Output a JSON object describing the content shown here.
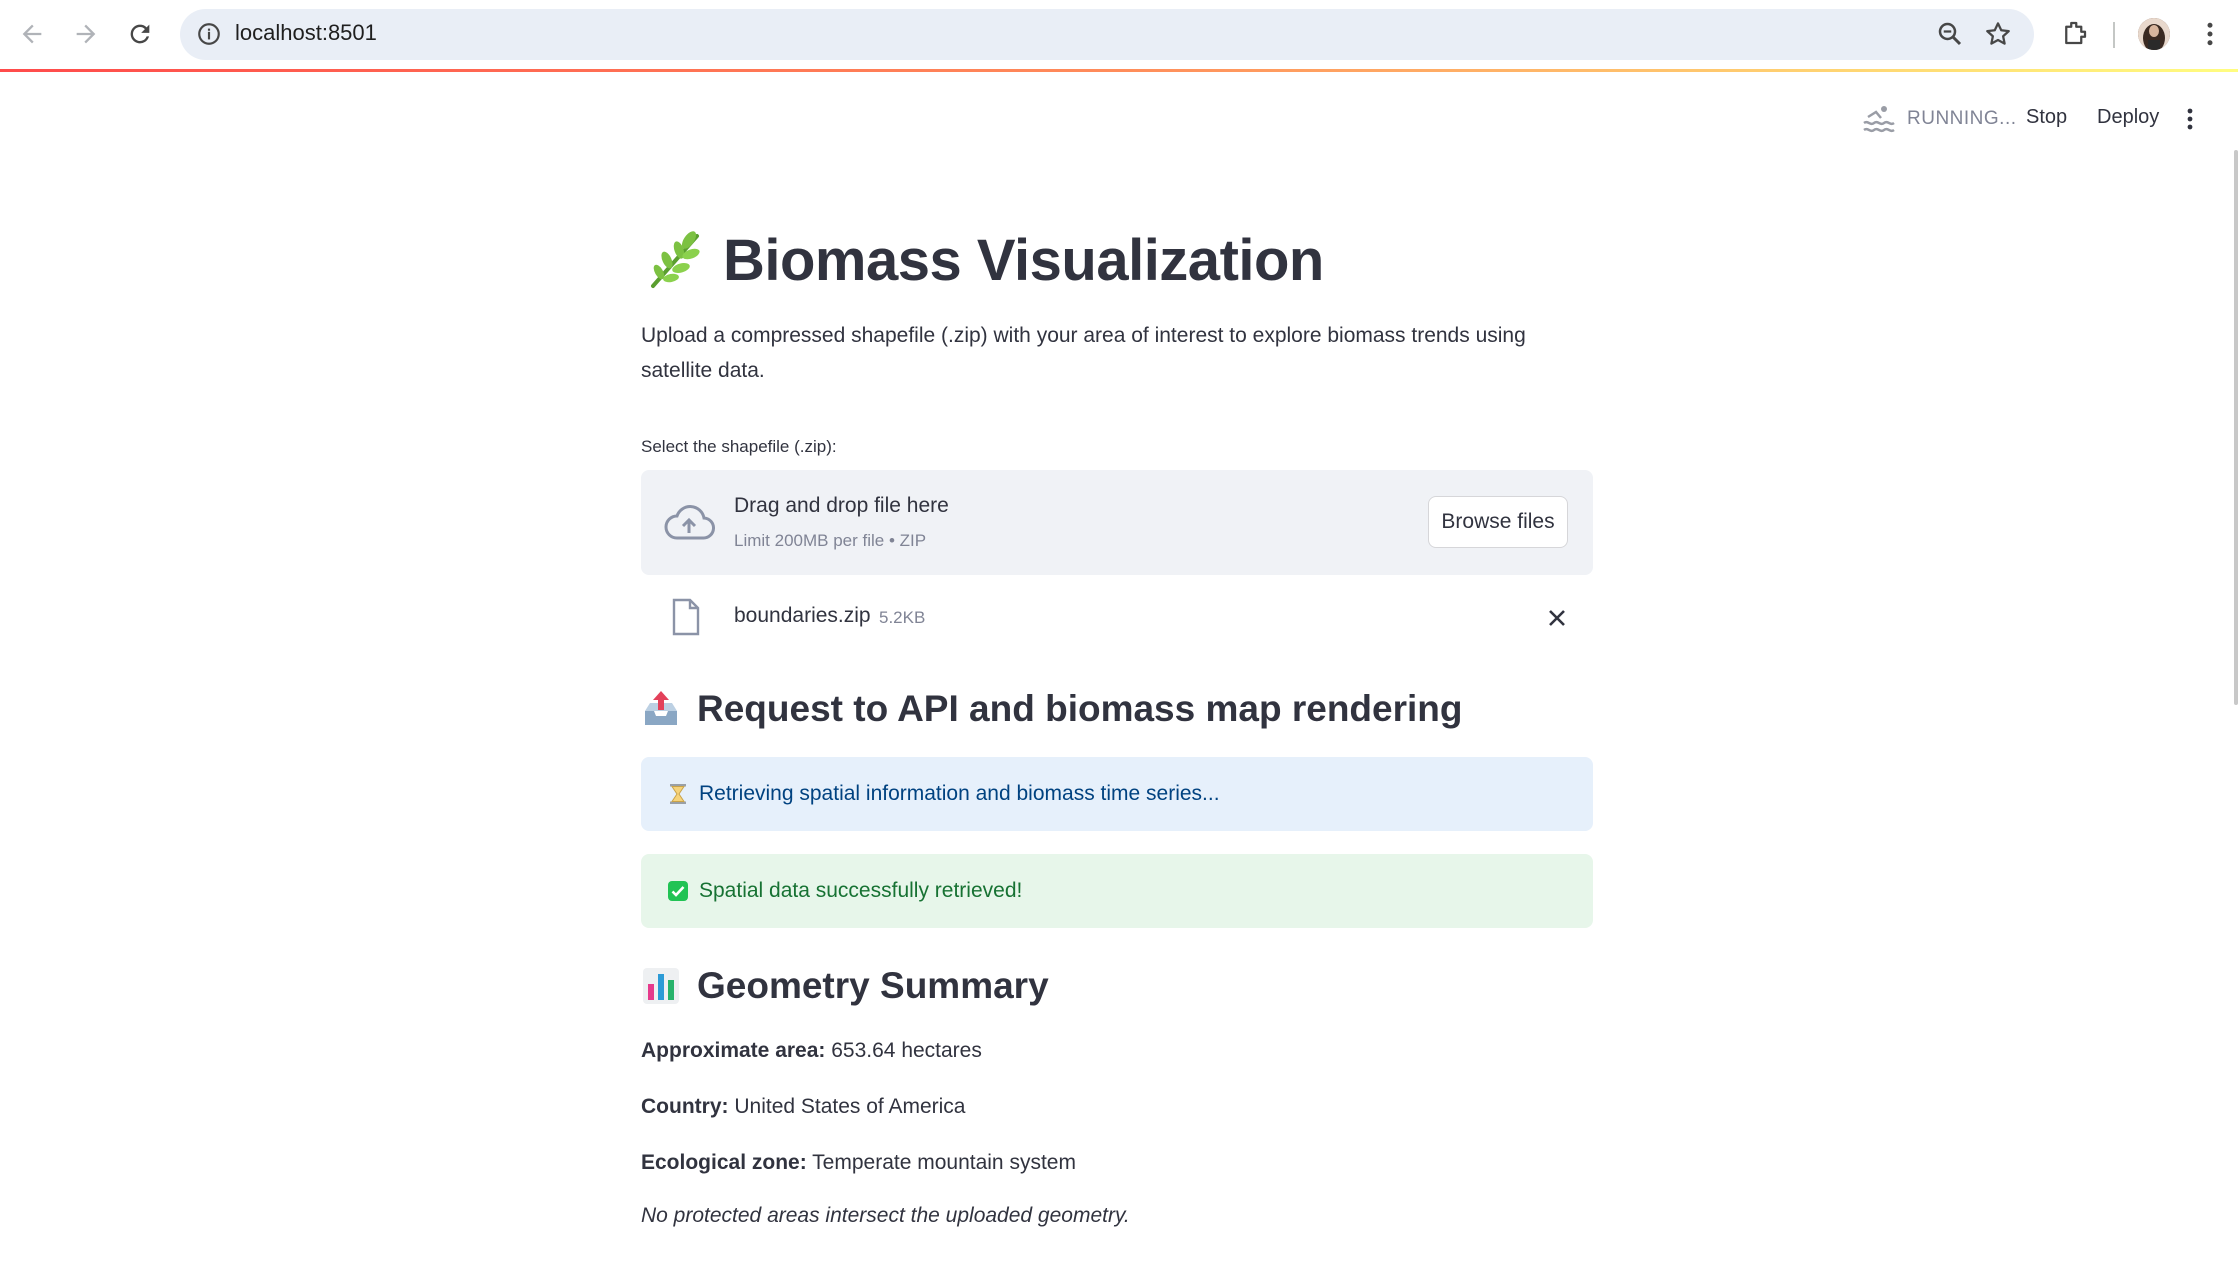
{
  "browser": {
    "url": "localhost:8501",
    "icons": [
      "back-icon",
      "forward-icon",
      "reload-icon",
      "info-icon",
      "zoom-icon",
      "bookmark-star-icon",
      "extensions-icon",
      "avatar",
      "menu-kebab-icon"
    ]
  },
  "header": {
    "status": "RUNNING...",
    "stop_label": "Stop",
    "deploy_label": "Deploy"
  },
  "page": {
    "title": "Biomass Visualization",
    "intro": "Upload a compressed shapefile (.zip) with your area of interest to explore biomass trends using satellite data.",
    "upload": {
      "label": "Select the shapefile (.zip):",
      "drop_title": "Drag and drop file here",
      "drop_sub": "Limit 200MB per file • ZIP",
      "browse_label": "Browse files",
      "file_name": "boundaries.zip",
      "file_size": "5.2KB"
    },
    "section_api": {
      "heading": "Request to API and biomass map rendering",
      "info": "Retrieving spatial information and biomass time series...",
      "success": "Spatial data successfully retrieved!"
    },
    "section_geometry": {
      "heading": "Geometry Summary",
      "area_label": "Approximate area:",
      "area_value": "653.64 hectares",
      "country_label": "Country:",
      "country_value": "United States of America",
      "zone_label": "Ecological zone:",
      "zone_value": "Temperate mountain system",
      "note": "No protected areas intersect the uploaded geometry."
    }
  },
  "colors": {
    "accent": "#ff4b4b",
    "info_bg": "#e6f0fb",
    "info_text": "#004280",
    "success_bg": "#e7f6ea",
    "success_text": "#177233"
  }
}
